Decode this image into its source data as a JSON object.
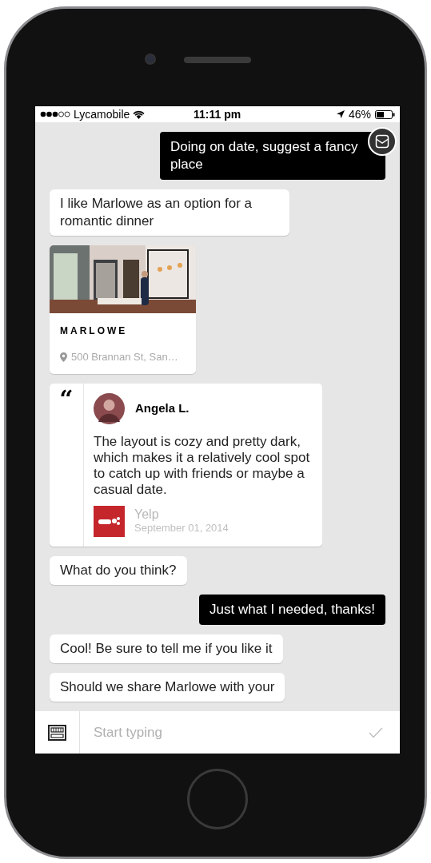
{
  "status_bar": {
    "carrier": "Lycamobile",
    "time": "11:11 pm",
    "battery": "46%"
  },
  "messages": [
    {
      "kind": "outgoing",
      "text": "Doing on date, suggest a fancy place"
    },
    {
      "kind": "incoming",
      "text": "I like Marlowe as an option for a romantic dinner"
    },
    {
      "kind": "place_card",
      "name": "MARLOWE",
      "address": "500 Brannan St, San…"
    },
    {
      "kind": "review",
      "quote_mark": "“",
      "author": "Angela L.",
      "text": "The layout is cozy and pretty dark, which makes it a relatively cool spot to catch up with friends or maybe a casual date.",
      "source": "Yelp",
      "date": "September 01, 2014"
    },
    {
      "kind": "incoming",
      "text": "What do you think?"
    },
    {
      "kind": "outgoing",
      "text": "Just what I needed, thanks!"
    },
    {
      "kind": "incoming",
      "text": "Cool! Be sure to tell me if you like it"
    },
    {
      "kind": "incoming",
      "text": "Should we share Marlowe with your"
    }
  ],
  "composer": {
    "placeholder": "Start typing"
  }
}
